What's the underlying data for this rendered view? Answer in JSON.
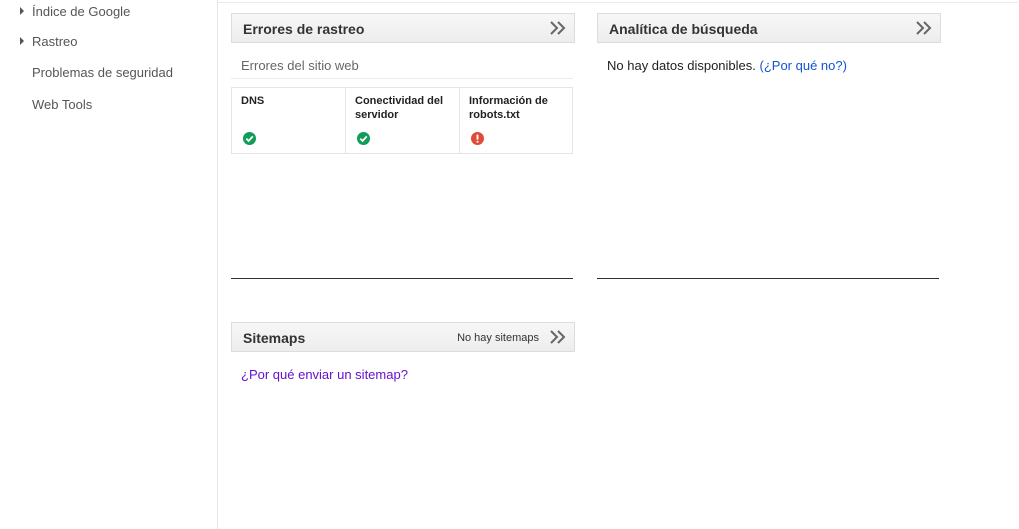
{
  "sidebar": {
    "items": [
      {
        "label": "Índice de Google",
        "expandable": true
      },
      {
        "label": "Rastreo",
        "expandable": true
      },
      {
        "label": "Problemas de seguridad",
        "expandable": false
      },
      {
        "label": "Web Tools",
        "expandable": false
      }
    ]
  },
  "crawl_errors": {
    "title": "Errores de rastreo",
    "section_label": "Errores del sitio web",
    "statuses": [
      {
        "label": "DNS",
        "status": "ok",
        "icon": "check-circle-icon",
        "color": "#0f9d58"
      },
      {
        "label": "Conectividad del servidor",
        "status": "ok",
        "icon": "check-circle-icon",
        "color": "#0f9d58"
      },
      {
        "label": "Información de robots.txt",
        "status": "error",
        "icon": "error-circle-icon",
        "color": "#dd4b39"
      }
    ]
  },
  "search_analytics": {
    "title": "Analítica de búsqueda",
    "no_data_text": "No hay datos disponibles.",
    "why_link": "(¿Por qué no?)"
  },
  "sitemaps": {
    "title": "Sitemaps",
    "status_text": "No hay sitemaps",
    "why_link": "¿Por qué enviar un sitemap?"
  },
  "colors": {
    "link": "#1155cc",
    "visited_link": "#6611cc",
    "ok": "#0f9d58",
    "error": "#dd4b39"
  }
}
